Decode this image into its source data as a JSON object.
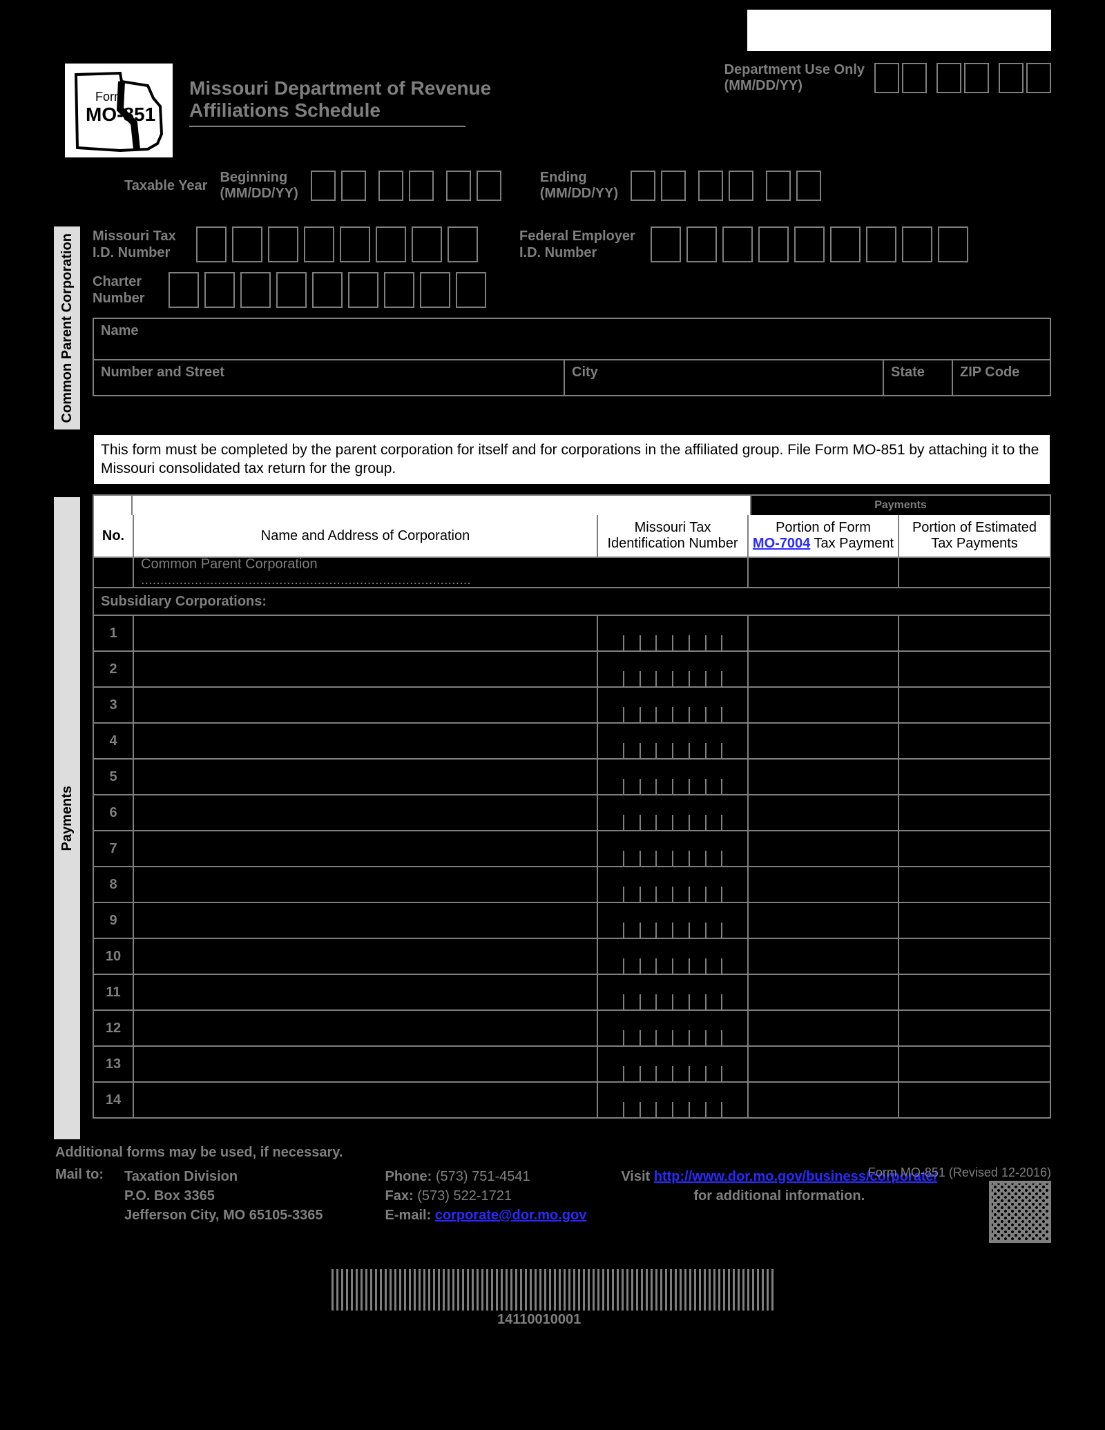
{
  "form": {
    "label": "Form",
    "number": "MO-851",
    "dept_title": "Missouri Department of Revenue",
    "sched_title": "Affiliations Schedule"
  },
  "dept_use": {
    "label1": "Department Use Only",
    "label2": "(MM/DD/YY)"
  },
  "taxable": {
    "title": "Taxable Year",
    "begin": "Beginning",
    "begin_fmt": "(MM/DD/YY)",
    "end": "Ending",
    "end_fmt": "(MM/DD/YY)"
  },
  "common": {
    "band": "Common Parent Corporation",
    "mo_tax": "Missouri Tax I.D. Number",
    "fein": "Federal Employer I.D. Number",
    "charter": "Charter Number",
    "name": "Name",
    "street": "Number and Street",
    "city": "City",
    "state": "State",
    "zip": "ZIP Code"
  },
  "instruction": "This form must be completed by the parent corporation for itself and for corporations in the affiliated group. File Form MO-851 by attaching it to the Missouri consolidated tax return for the group.",
  "payments": {
    "band": "Payments",
    "head_payments": "Payments",
    "col_no": "No.",
    "col_name": "Name and Address of Corporation",
    "col_tax": "Missouri Tax Identification Number",
    "col_pay1_a": "Portion of Form",
    "col_pay1_link": "MO-7004",
    "col_pay1_b": " Tax Payment",
    "col_pay2": "Portion of Estimated Tax Payments",
    "cpc_row": "Common Parent Corporation ......................................................................................",
    "sub_head": "Subsidiary Corporations:",
    "rows": [
      "1",
      "2",
      "3",
      "4",
      "5",
      "6",
      "7",
      "8",
      "9",
      "10",
      "11",
      "12",
      "13",
      "14"
    ]
  },
  "additional": "Additional forms may be used, if necessary.",
  "footer": {
    "mailto": "Mail to:",
    "addr1": "Taxation Division",
    "addr2": "P.O. Box 3365",
    "addr3": "Jefferson City, MO 65105-3365",
    "phone_l": "Phone:",
    "phone": "(573) 751-4541",
    "fax_l": "Fax:",
    "fax": "(573) 522-1721",
    "email_l": "E-mail:",
    "email": "corporate@dor.mo.gov",
    "visit": "Visit",
    "url": "http://www.dor.mo.gov/business/corporate/",
    "info": "for additional information.",
    "rev": "Form MO-851  (Revised 12-2016)"
  },
  "barcode_num": "14110010001"
}
